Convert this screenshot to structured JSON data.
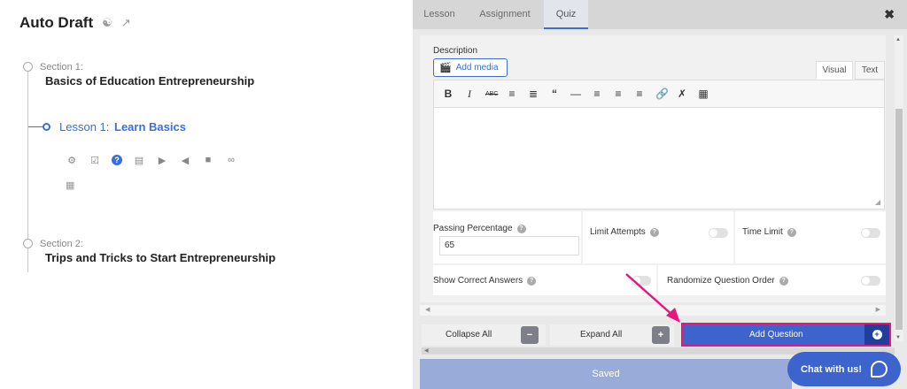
{
  "course": {
    "title": "Auto Draft",
    "icons": [
      "wordpress-icon",
      "external-link-icon"
    ]
  },
  "outline": {
    "sections": [
      {
        "label": "Section 1:",
        "title": "Basics of Education Entrepreneurship"
      },
      {
        "label": "Section 2:",
        "title": "Trips and Tricks to Start Entrepreneurship"
      }
    ],
    "lesson": {
      "label": "Lesson 1:",
      "title": "Learn Basics"
    },
    "lesson_tool_icons": [
      "gear-icon",
      "checkbox-icon",
      "question-icon",
      "document-icon",
      "play-icon",
      "audio-icon",
      "lock-icon",
      "unlink-icon",
      "calendar-icon"
    ]
  },
  "panel": {
    "tabs": [
      "Lesson",
      "Assignment",
      "Quiz"
    ],
    "active_tab": "Quiz",
    "close_label": "✖",
    "description": {
      "label": "Description",
      "add_media": "Add media",
      "editor_tabs": {
        "visual": "Visual",
        "text": "Text"
      },
      "toolbar_icons": [
        "bold",
        "italic",
        "strikethrough",
        "bullet-list",
        "numbered-list",
        "blockquote",
        "horizontal-line",
        "align-left",
        "align-center",
        "align-right",
        "link",
        "unlink",
        "toolbar-toggle"
      ],
      "content": ""
    },
    "settings": {
      "passing_percentage": {
        "label": "Passing Percentage",
        "value": "65"
      },
      "limit_attempts": {
        "label": "Limit Attempts",
        "enabled": false
      },
      "time_limit": {
        "label": "Time Limit",
        "enabled": false
      },
      "show_correct_answers": {
        "label": "Show Correct Answers",
        "enabled": false
      },
      "randomize_question_order": {
        "label": "Randomize Question Order",
        "enabled": false
      }
    },
    "buttons": {
      "collapse_all": "Collapse All",
      "expand_all": "Expand All",
      "add_question": "Add Question",
      "saved": "Saved"
    }
  },
  "chat": {
    "label": "Chat with us!"
  },
  "colors": {
    "accent": "#3d63cc",
    "highlight": "#e4167f",
    "saved_button": "#99acd9"
  }
}
